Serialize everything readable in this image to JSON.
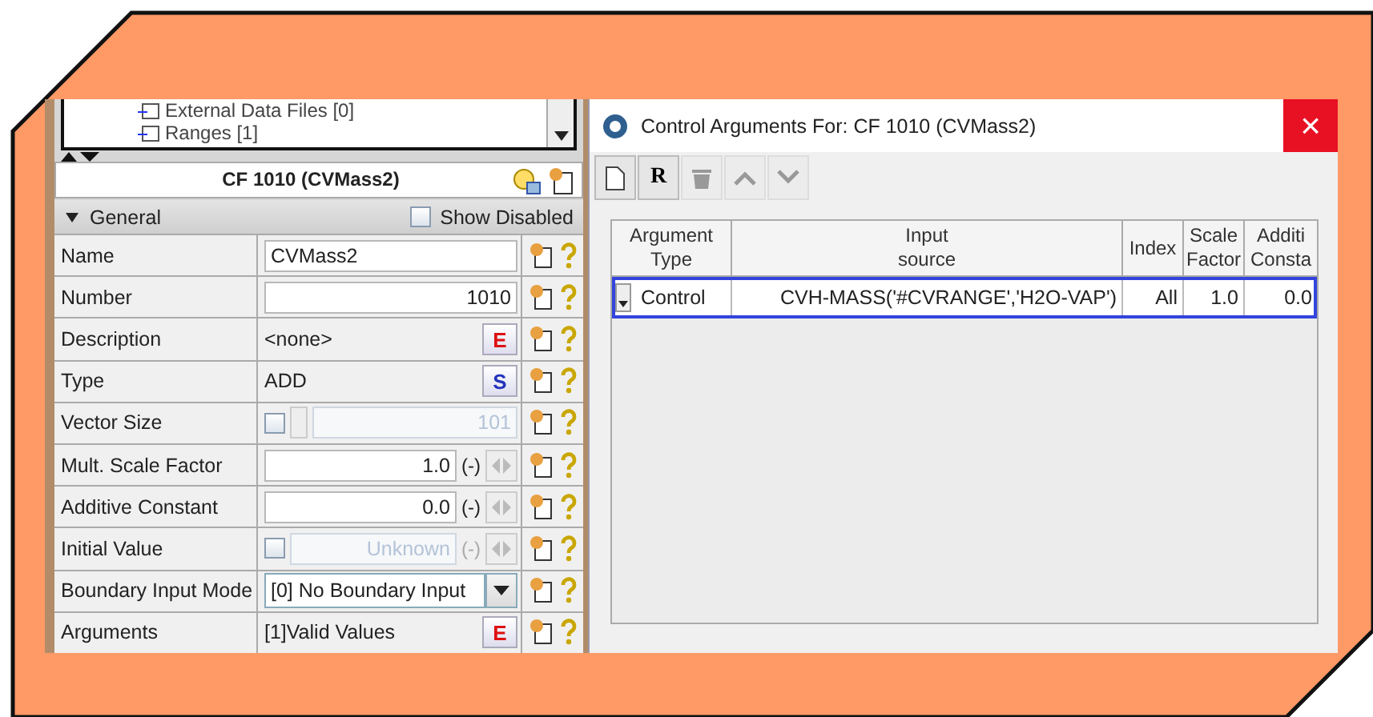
{
  "tree": {
    "items": [
      "External Data Files [0]",
      "Ranges [1]"
    ]
  },
  "panel": {
    "title": "CF 1010 (CVMass2)",
    "section": {
      "label": "General",
      "expanded": true
    },
    "show_disabled": {
      "label": "Show Disabled",
      "checked": false
    },
    "rows": [
      {
        "label": "Name",
        "kind": "text",
        "value": "CVMass2"
      },
      {
        "label": "Number",
        "kind": "number",
        "value": "1010"
      },
      {
        "label": "Description",
        "kind": "editor",
        "value": "<none>",
        "button": "E"
      },
      {
        "label": "Type",
        "kind": "select",
        "value": "ADD",
        "button": "S"
      },
      {
        "label": "Vector Size",
        "kind": "vector",
        "value": "101",
        "checked": false
      },
      {
        "label": "Mult. Scale Factor",
        "kind": "unit",
        "value": "1.0",
        "unit": "(-)"
      },
      {
        "label": "Additive Constant",
        "kind": "unit",
        "value": "0.0",
        "unit": "(-)"
      },
      {
        "label": "Initial Value",
        "kind": "optional-unit",
        "value": "Unknown",
        "unit": "(-)",
        "checked": false
      },
      {
        "label": "Boundary Input Mode",
        "kind": "dropdown",
        "value": "[0] No Boundary Input"
      },
      {
        "label": "Arguments",
        "kind": "editor",
        "value": "[1]Valid Values",
        "button": "E"
      }
    ]
  },
  "dialog": {
    "title": "Control Arguments For: CF 1010 (CVMass2)",
    "close": "×",
    "toolbar": [
      {
        "kind": "new",
        "disabled": false
      },
      {
        "kind": "letter",
        "label": "R",
        "disabled": false
      },
      {
        "kind": "delete",
        "disabled": true
      },
      {
        "kind": "up",
        "disabled": true
      },
      {
        "kind": "down",
        "disabled": true
      }
    ],
    "table": {
      "columns": [
        "Argument\nType",
        "Input\nsource",
        "Index",
        "Scale\nFactor",
        "Additi\nConsta"
      ],
      "rows": [
        {
          "selected": true,
          "cells": [
            "Control",
            "CVH-MASS('#CVRANGE','H2O-VAP')",
            "All",
            "1.0",
            "0.0"
          ]
        }
      ]
    }
  }
}
